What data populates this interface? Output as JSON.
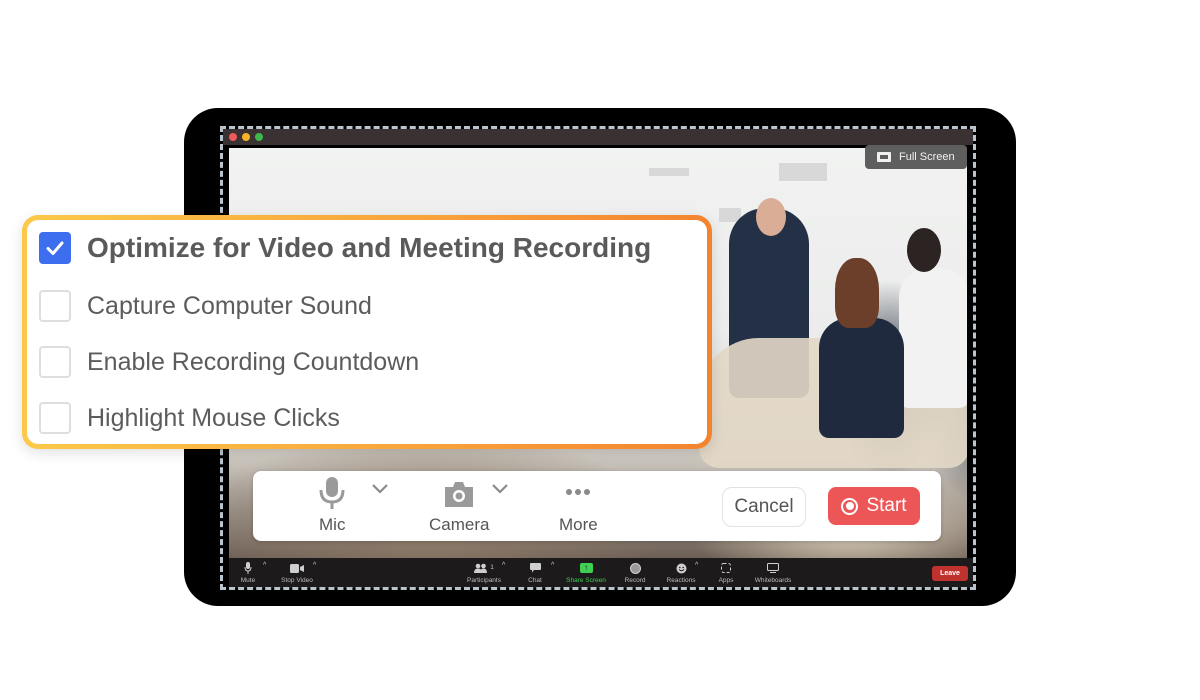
{
  "window": {
    "traffic_lights": [
      "close",
      "minimize",
      "maximize"
    ],
    "full_screen_label": "Full Screen"
  },
  "options": [
    {
      "label": "Optimize for Video and Meeting Recording",
      "checked": true
    },
    {
      "label": "Capture Computer Sound",
      "checked": false
    },
    {
      "label": "Enable Recording Countdown",
      "checked": false
    },
    {
      "label": "Highlight Mouse Clicks",
      "checked": false
    }
  ],
  "recording_bar": {
    "mic_label": "Mic",
    "camera_label": "Camera",
    "more_label": "More",
    "cancel_label": "Cancel",
    "start_label": "Start"
  },
  "meeting_toolbar": {
    "mute": "Mute",
    "stop_video": "Stop Video",
    "participants": "Participants",
    "participants_count": "1",
    "chat": "Chat",
    "share_screen": "Share Screen",
    "record": "Record",
    "reactions": "Reactions",
    "apps": "Apps",
    "whiteboards": "Whiteboards",
    "leave": "Leave"
  },
  "colors": {
    "checkbox_checked": "#3d6ef0",
    "start_button": "#ec5656",
    "leave_button": "#c0322d",
    "share_screen_green": "#3fcf53",
    "card_border_start": "#fbc94a",
    "card_border_end": "#f3842f"
  }
}
